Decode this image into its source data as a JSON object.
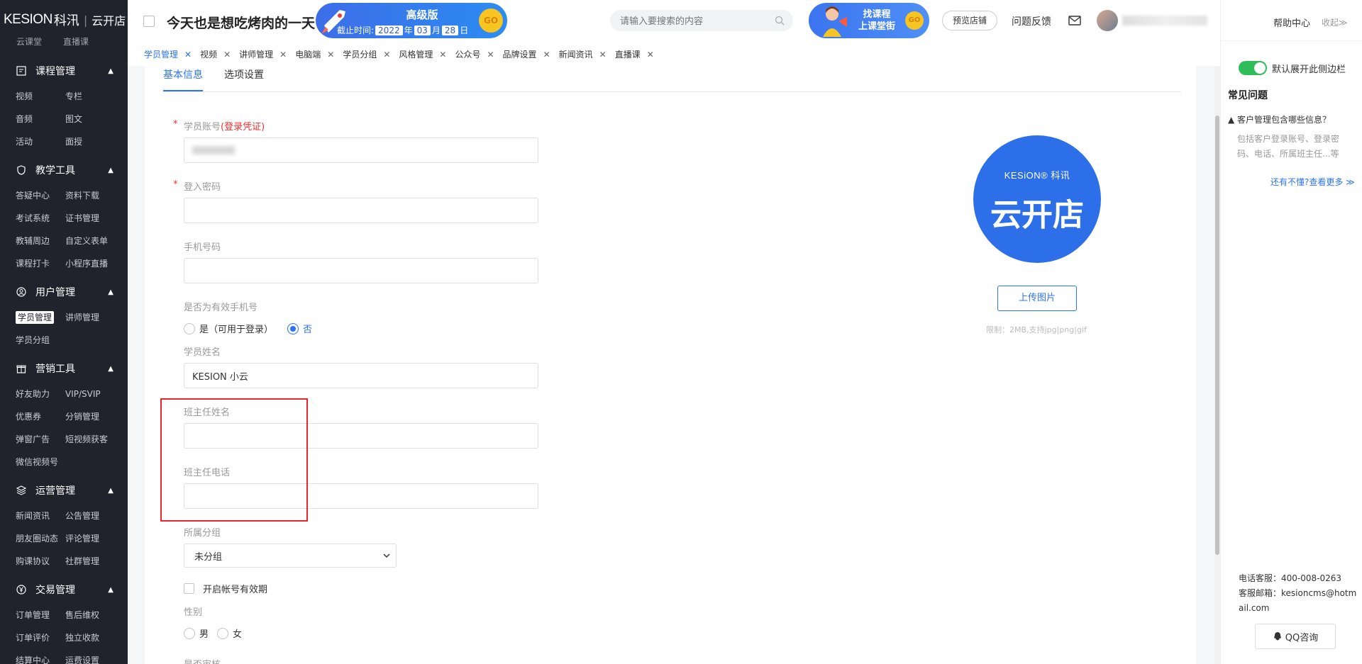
{
  "sidebar": {
    "logo_brand": "KESION",
    "logo_brand_cn": "科汛",
    "logo_sub": "云开店",
    "cut_items": [
      "云课堂",
      "直播课"
    ],
    "groups": [
      {
        "title": "课程管理",
        "icon": "course-icon",
        "items": [
          "视频",
          "专栏",
          "音频",
          "图文",
          "活动",
          "面授"
        ]
      },
      {
        "title": "教学工具",
        "icon": "teaching-icon",
        "items": [
          "答疑中心",
          "资料下载",
          "考试系统",
          "证书管理",
          "教辅周边",
          "自定义表单",
          "课程打卡",
          "小程序直播"
        ]
      },
      {
        "title": "用户管理",
        "icon": "user-icon",
        "items": [
          "学员管理",
          "讲师管理",
          "学员分组"
        ]
      },
      {
        "title": "营销工具",
        "icon": "gift-icon",
        "items": [
          "好友助力",
          "VIP/SVIP",
          "优惠券",
          "分销管理",
          "弹窗广告",
          "短视频获客",
          "微信视频号"
        ]
      },
      {
        "title": "运营管理",
        "icon": "layers-icon",
        "items": [
          "新闻资讯",
          "公告管理",
          "朋友圈动态",
          "评论管理",
          "购课协议",
          "社群管理"
        ]
      },
      {
        "title": "交易管理",
        "icon": "yen-icon",
        "items": [
          "订单管理",
          "售后维权",
          "订单评价",
          "独立收款",
          "结算中心",
          "运费设置"
        ]
      }
    ]
  },
  "header": {
    "headline": "今天也是想吃烤肉的一天",
    "promo": {
      "plan": "高级版",
      "deadline_label": "截止时间:",
      "year": "2022",
      "year_unit": "年",
      "month": "03",
      "month_unit": "月",
      "day": "28",
      "day_unit": "日",
      "go": "GO"
    },
    "search_placeholder": "请输入要搜索的内容",
    "course_promo": {
      "line1": "找课程",
      "line2": "上课堂街",
      "go": "GO"
    },
    "preview_button": "预览店铺",
    "feedback": "问题反馈"
  },
  "tabs": [
    {
      "label": "学员管理",
      "active": true
    },
    {
      "label": "视频",
      "active": false
    },
    {
      "label": "讲师管理",
      "active": false
    },
    {
      "label": "电脑端",
      "active": false
    },
    {
      "label": "学员分组",
      "active": false
    },
    {
      "label": "风格管理",
      "active": false
    },
    {
      "label": "公众号",
      "active": false
    },
    {
      "label": "品牌设置",
      "active": false
    },
    {
      "label": "新闻资讯",
      "active": false
    },
    {
      "label": "直播课",
      "active": false
    }
  ],
  "form": {
    "subtabs": [
      "基本信息",
      "选项设置"
    ],
    "account_label": "学员账号",
    "account_note": "(登录凭证)",
    "password_label": "登入密码",
    "phone_label": "手机号码",
    "valid_phone_label": "是否为有效手机号",
    "valid_phone_yes": "是（可用于登录）",
    "valid_phone_no": "否",
    "valid_phone_selected": "否",
    "name_label": "学员姓名",
    "name_value": "KESION  小云",
    "teacher_name_label": "班主任姓名",
    "teacher_phone_label": "班主任电话",
    "group_label": "所属分组",
    "group_value": "未分组",
    "expiry_label": "开启帐号有效期",
    "gender_label": "性别",
    "gender_male": "男",
    "gender_female": "女",
    "cut_label": "是否审核"
  },
  "image_panel": {
    "logo_line1": "KESiON® 科讯",
    "logo_line2": "云开店",
    "upload_button": "上传图片",
    "limit_text": "限制：2MB,支持jpg|png|gif"
  },
  "right_panel": {
    "help_center": "帮助中心",
    "fold": "收起≫",
    "toggle_label": "默认展开此侧边栏",
    "toggle_on": true,
    "faq_title": "常见问题",
    "faq_question": "▲ 客户管理包含哪些信息？",
    "faq_answer": "包括客户登录账号、登录密码、电话、所属班主任...等",
    "faq_more": "还有不懂?查看更多 ≫",
    "phone_service": "电话客服：400-008-0263",
    "email_service": "客服邮箱：kesioncms@hotmail.com",
    "qq_button": "QQ咨询"
  }
}
